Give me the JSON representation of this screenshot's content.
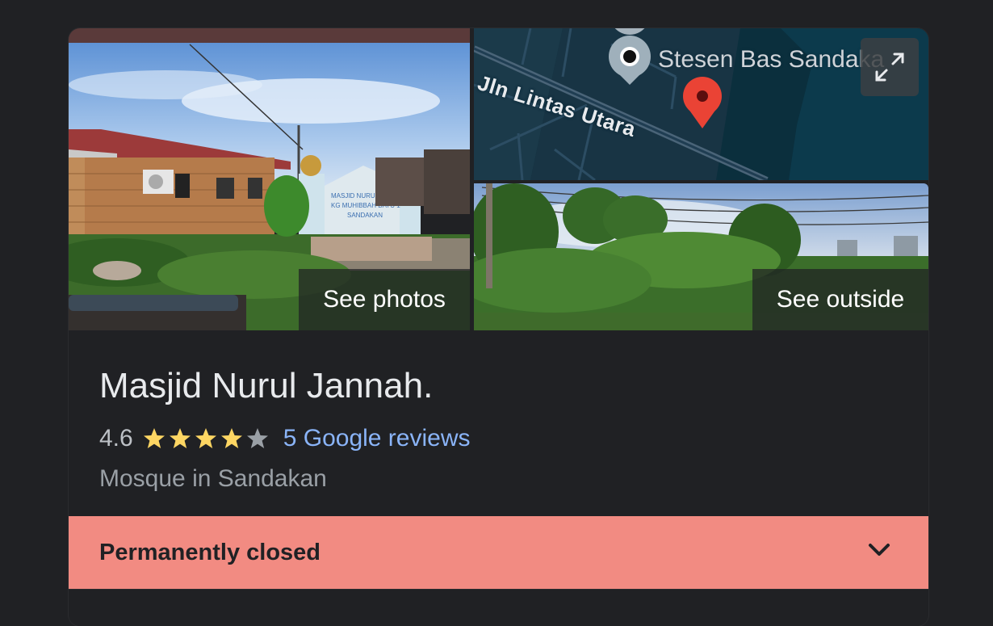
{
  "panel": {
    "see_photos_label": "See photos",
    "see_outside_label": "See outside",
    "map": {
      "street_label": "Jln Lintas Utara",
      "poi_label": "Stesen Bas Sandaka",
      "expand_icon": "expand-icon"
    },
    "place": {
      "name": "Masjid Nurul Jannah.",
      "rating": "4.6",
      "rating_value": 4.6,
      "rating_max": 5,
      "reviews_label": "5 Google reviews",
      "category": "Mosque in Sandakan"
    },
    "status": {
      "label": "Permanently closed",
      "icon": "chevron-down-icon"
    },
    "colors": {
      "background": "#202124",
      "closed_banner": "#f28b82",
      "link": "#8ab4f8",
      "star": "#fdd663",
      "map_pin": "#ea4335"
    },
    "photo_sign_text": "MASJID NURUL JANNAH KG MUHIBBAH SANDAKAN"
  }
}
